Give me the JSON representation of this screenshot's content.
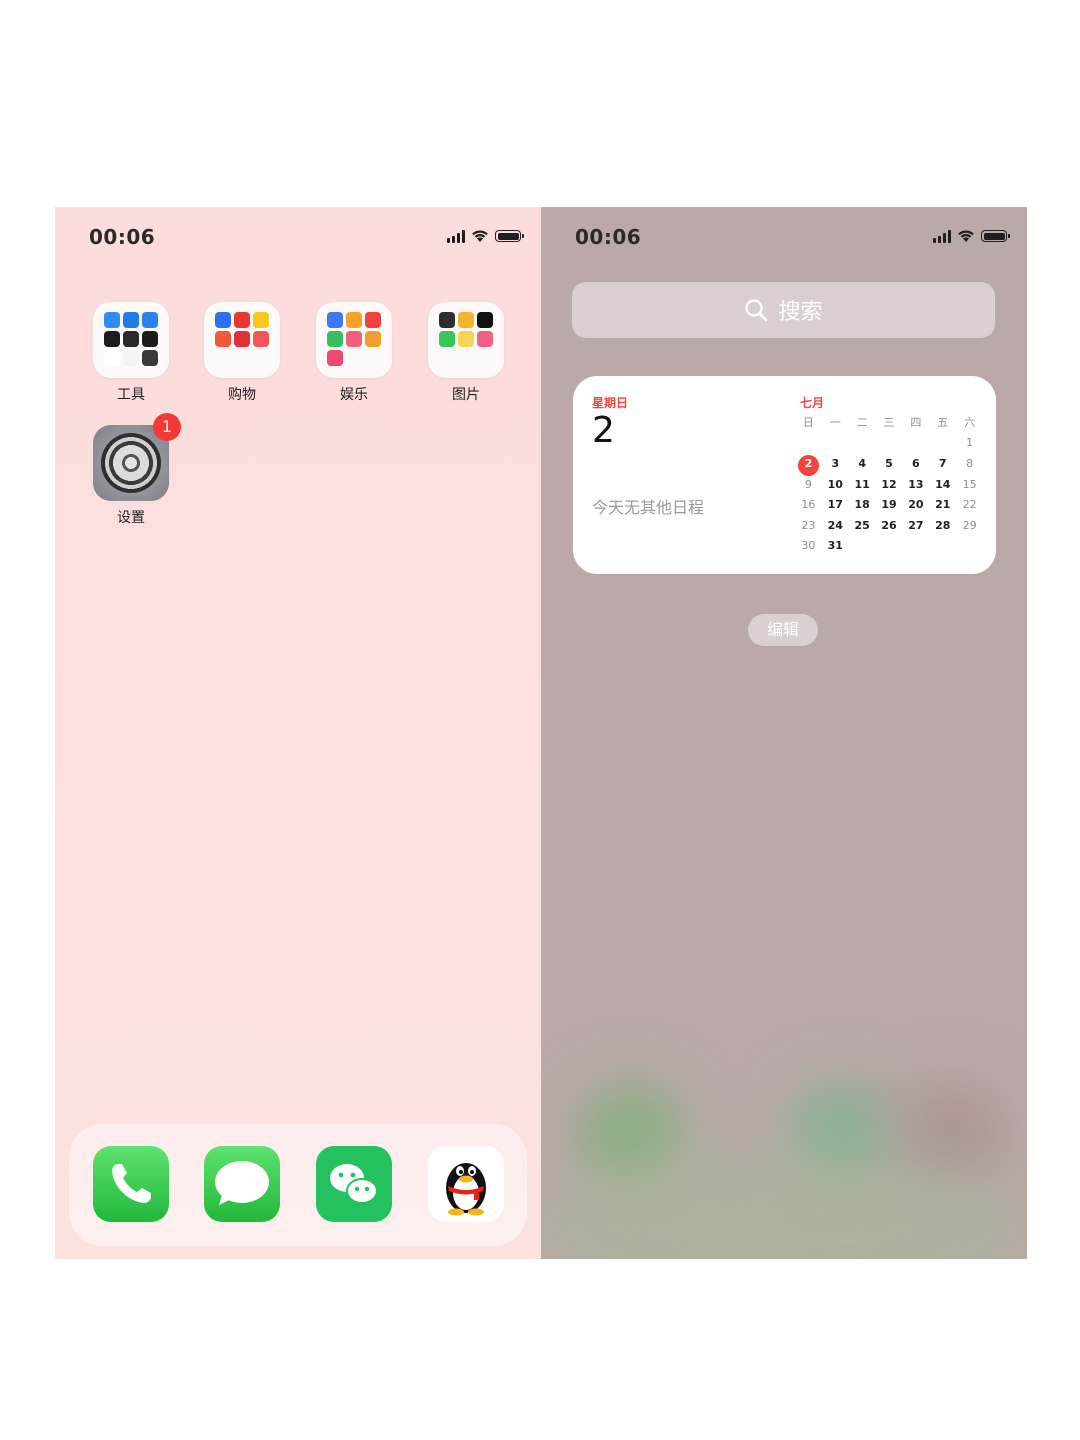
{
  "home": {
    "time": "00:06",
    "folders": [
      {
        "label": "工具",
        "colors": [
          "#2f8cf2",
          "#1f7de6",
          "#2b83f0",
          "#1c1c1e",
          "#2a2a2a",
          "#1c1c1e",
          "#ffffff",
          "#f4f4f4",
          "#3a3a3a"
        ]
      },
      {
        "label": "购物",
        "colors": [
          "#2f6ff0",
          "#e9382f",
          "#f6c91b",
          "#ef5a3a",
          "#e0303a",
          "#f15656"
        ]
      },
      {
        "label": "娱乐",
        "colors": [
          "#3e79f5",
          "#f7a128",
          "#f24040",
          "#36bf63",
          "#f15f7e",
          "#f59d2c",
          "#ef4a6b"
        ]
      },
      {
        "label": "图片",
        "colors": [
          "#2e2e30",
          "#f3b52f",
          "#111111",
          "#35c759",
          "#f7d554",
          "#f25f85"
        ]
      }
    ],
    "settings": {
      "label": "设置",
      "badge": "1"
    },
    "dock": [
      {
        "name": "phone",
        "color": "#31c94c"
      },
      {
        "name": "messages",
        "color": "#31c94c"
      },
      {
        "name": "wechat",
        "color": "#23c160"
      },
      {
        "name": "qq",
        "color": "#ffffff"
      }
    ]
  },
  "today": {
    "time": "00:06",
    "search_placeholder": "搜索",
    "widget": {
      "weekday": "星期日",
      "date": "2",
      "note": "今天无其他日程",
      "month": "七月",
      "weekdays": [
        "日",
        "一",
        "二",
        "三",
        "四",
        "五",
        "六"
      ],
      "weeks": [
        [
          "",
          "",
          "",
          "",
          "",
          "",
          "1"
        ],
        [
          "2",
          "3",
          "4",
          "5",
          "6",
          "7",
          "8"
        ],
        [
          "9",
          "10",
          "11",
          "12",
          "13",
          "14",
          "15"
        ],
        [
          "16",
          "17",
          "18",
          "19",
          "20",
          "21",
          "22"
        ],
        [
          "23",
          "24",
          "25",
          "26",
          "27",
          "28",
          "29"
        ],
        [
          "30",
          "31",
          "",
          "",
          "",
          "",
          ""
        ]
      ],
      "today": "2"
    },
    "edit_label": "编辑"
  }
}
